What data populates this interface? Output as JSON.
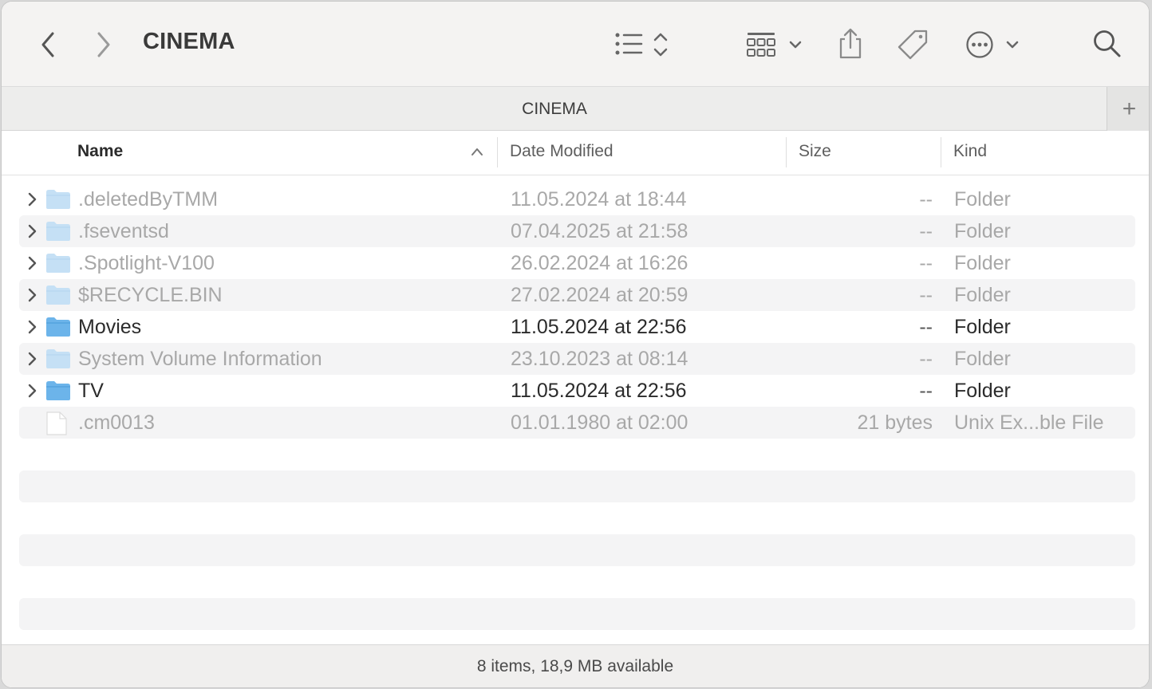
{
  "window": {
    "title": "CINEMA"
  },
  "toolbar": {
    "back_icon": "chevron-left-icon",
    "forward_icon": "chevron-right-icon",
    "view_icon": "list-view-icon",
    "group_icon": "grid-group-icon",
    "share_icon": "share-icon",
    "tag_icon": "tag-icon",
    "more_icon": "ellipsis-circle-icon",
    "search_icon": "search-icon"
  },
  "tabs": {
    "current": "CINEMA",
    "add_label": "+"
  },
  "columns": {
    "name": "Name",
    "date": "Date Modified",
    "size": "Size",
    "kind": "Kind",
    "sort": "name-ascending"
  },
  "files": [
    {
      "name": ".deletedByTMM",
      "date": "11.05.2024 at 18:44",
      "size": "--",
      "kind": "Folder",
      "type": "folder",
      "hidden": true
    },
    {
      "name": ".fseventsd",
      "date": "07.04.2025 at 21:58",
      "size": "--",
      "kind": "Folder",
      "type": "folder",
      "hidden": true
    },
    {
      "name": ".Spotlight-V100",
      "date": "26.02.2024 at 16:26",
      "size": "--",
      "kind": "Folder",
      "type": "folder",
      "hidden": true
    },
    {
      "name": "$RECYCLE.BIN",
      "date": "27.02.2024 at 20:59",
      "size": "--",
      "kind": "Folder",
      "type": "folder",
      "hidden": true
    },
    {
      "name": "Movies",
      "date": "11.05.2024 at 22:56",
      "size": "--",
      "kind": "Folder",
      "type": "folder",
      "hidden": false
    },
    {
      "name": "System Volume Information",
      "date": "23.10.2023 at 08:14",
      "size": "--",
      "kind": "Folder",
      "type": "folder",
      "hidden": true
    },
    {
      "name": "TV",
      "date": "11.05.2024 at 22:56",
      "size": "--",
      "kind": "Folder",
      "type": "folder",
      "hidden": false
    },
    {
      "name": ".cm0013",
      "date": "01.01.1980 at 02:00",
      "size": "21 bytes",
      "kind": "Unix Ex...ble File",
      "type": "file",
      "hidden": true
    }
  ],
  "status": {
    "text": "8 items, 18,9 MB available"
  },
  "colors": {
    "folder": "#6cb4ea",
    "folder_dim": "#c5e0f5",
    "alt_row": "#f4f4f5"
  }
}
